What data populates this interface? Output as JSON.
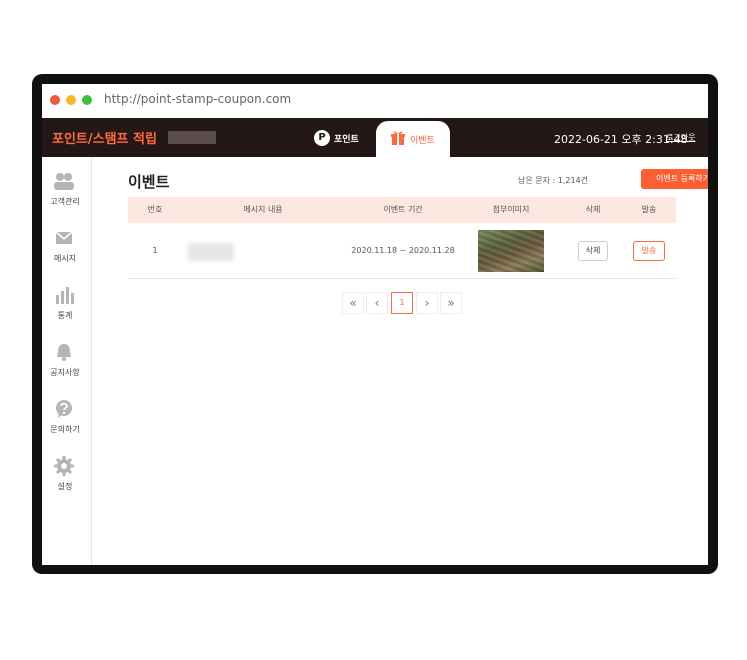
{
  "browser": {
    "url": "http://point-stamp-coupon.com"
  },
  "header": {
    "brand": "포인트/스탬프 적립",
    "tabs": [
      {
        "label": "포인트",
        "icon": "p-circle-icon"
      },
      {
        "label": "이벤트",
        "icon": "gift-icon",
        "active": true
      }
    ],
    "datetime": "2022-06-21 오후 2:31:48",
    "logout": "로그아웃"
  },
  "sidebar": {
    "items": [
      {
        "label": "고객관리",
        "icon": "users-icon"
      },
      {
        "label": "메시지",
        "icon": "envelope-icon"
      },
      {
        "label": "통계",
        "icon": "bar-chart-icon"
      },
      {
        "label": "공지사항",
        "icon": "bell-icon"
      },
      {
        "label": "문의하기",
        "icon": "question-icon"
      },
      {
        "label": "설정",
        "icon": "gear-icon"
      }
    ]
  },
  "main": {
    "title": "이벤트",
    "remaining": "남은 문자 : 1,214건",
    "register_button": "이벤트 등록하기",
    "table": {
      "columns": [
        "번호",
        "메시지 내용",
        "이벤트 기간",
        "첨부이미지",
        "삭제",
        "발송"
      ],
      "rows": [
        {
          "no": "1",
          "period": "2020.11.18 ~ 2020.11.28",
          "delete_label": "삭제",
          "send_label": "발송"
        }
      ]
    },
    "pagination": {
      "first": "«",
      "prev": "‹",
      "current": "1",
      "next": "›",
      "last": "»"
    }
  },
  "colors": {
    "accent": "#ff5e32",
    "header_bg": "#241816",
    "table_head_bg": "#fde8e1"
  }
}
